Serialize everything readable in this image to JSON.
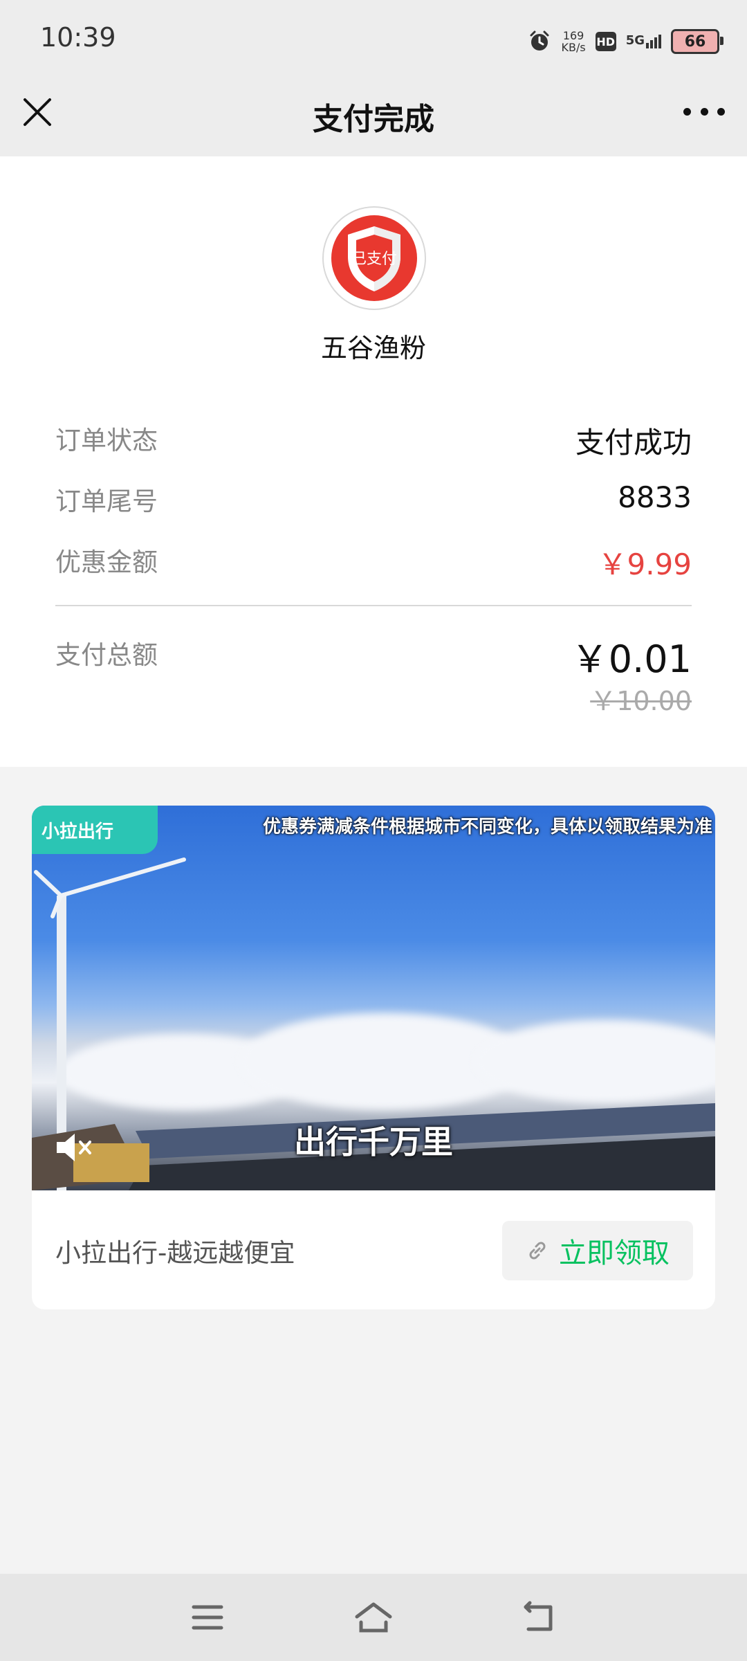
{
  "status_bar": {
    "time": "10:39",
    "net_speed_value": "169",
    "net_speed_unit": "KB/s",
    "hd": "HD",
    "signal": "5G",
    "battery": "66",
    "icons": [
      "alarm-icon",
      "hd-icon",
      "signal-5g-icon",
      "battery-icon"
    ]
  },
  "nav": {
    "title": "支付完成",
    "close_icon": "close-icon",
    "more_icon": "more-icon"
  },
  "merchant": {
    "badge_text": "已支付",
    "name": "五谷渔粉"
  },
  "order": {
    "rows": [
      {
        "label": "订单状态",
        "value": "支付成功"
      },
      {
        "label": "订单尾号",
        "value": "8833"
      },
      {
        "label": "优惠金额",
        "value": "￥9.99"
      }
    ],
    "total_label": "支付总额",
    "total_value": "￥0.01",
    "original_value": "￥10.00",
    "accent_red": "#e64340"
  },
  "ad": {
    "brand_tag": "小拉出行",
    "notice": "优惠券满减条件根据城市不同变化，具体以领取结果为准",
    "caption": "出行千万里",
    "name": "小拉出行-越远越便宜",
    "button_label": "立即领取",
    "button_color": "#07c160",
    "mute_icon": "mute-icon",
    "link_icon": "link-icon"
  },
  "system_nav": {
    "icons": [
      "menu-icon",
      "home-icon",
      "back-icon"
    ]
  }
}
